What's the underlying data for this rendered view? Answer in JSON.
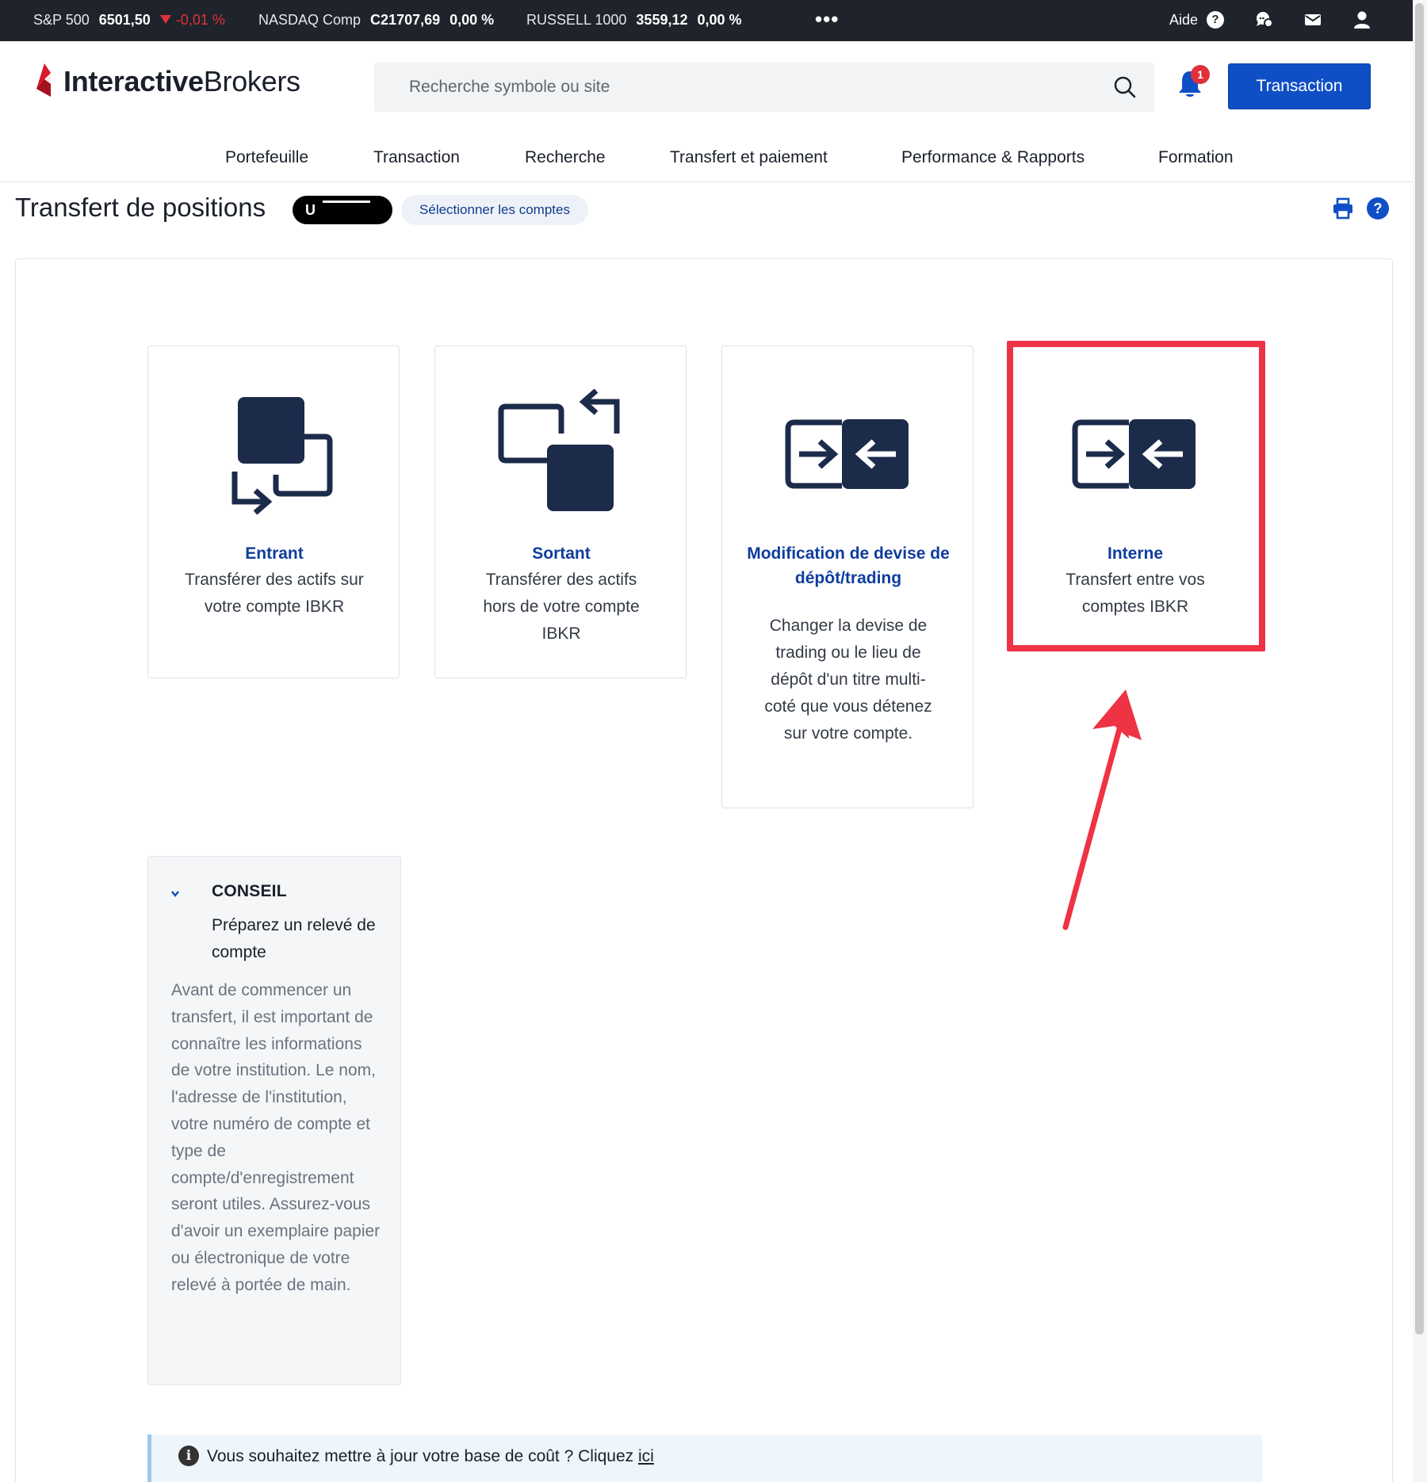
{
  "ticker": {
    "items": [
      {
        "name": "S&P 500",
        "value": "6501,50",
        "change": "-0,01 %",
        "direction": "down"
      },
      {
        "name": "NASDAQ Comp",
        "value": "C21707,69",
        "change": "0,00 %",
        "direction": "flat"
      },
      {
        "name": "RUSSELL 1000",
        "value": "3559,12",
        "change": "0,00 %",
        "direction": "flat"
      }
    ],
    "more": "•••",
    "help_label": "Aide",
    "help_glyph": "?",
    "icons": [
      "chat-icon",
      "mail-icon",
      "user-icon"
    ]
  },
  "header": {
    "logo_interactive": "Interactive",
    "logo_brokers": "Brokers",
    "search_placeholder": "Recherche symbole ou site",
    "notifications_count": "1",
    "trade_button": "Transaction"
  },
  "nav": {
    "items": [
      "Portefeuille",
      "Transaction",
      "Recherche",
      "Transfert et paiement",
      "Performance & Rapports",
      "Formation"
    ]
  },
  "page": {
    "title": "Transfert de positions",
    "account_prefix": "U",
    "select_accounts": "Sélectionner les comptes",
    "help_glyph": "?"
  },
  "cards": [
    {
      "title": "Entrant",
      "description": "Transférer des actifs sur votre compte IBKR",
      "icon": "incoming-transfer-icon"
    },
    {
      "title": "Sortant",
      "description": "Transférer des actifs hors de votre compte IBKR",
      "icon": "outgoing-transfer-icon"
    },
    {
      "title": "Modification de devise de dépôt/trading",
      "description": "Changer la devise de trading ou le lieu de dépôt d'un titre multi-coté que vous détenez sur votre compte.",
      "icon": "exchange-arrows-icon"
    },
    {
      "title": "Interne",
      "description": "Transfert entre vos comptes IBKR",
      "icon": "exchange-arrows-icon"
    }
  ],
  "tip": {
    "heading": "CONSEIL",
    "subheading": "Préparez un relevé de compte",
    "body": "Avant de commencer un transfert, il est important de connaître les informations de votre institution. Le nom, l'adresse de l'institution, votre numéro de compte et type de compte/d'enregistrement seront utiles. Assurez-vous d'avoir un exemplaire papier ou électronique de votre relevé à portée de main."
  },
  "info_banner": {
    "icon_glyph": "i",
    "message": "Vous souhaitez mettre à jour votre base de coût ? Cliquez ",
    "link": "ici"
  },
  "colors": {
    "brand_blue": "#0f4fc6",
    "link_blue": "#0f3d9e",
    "icon_navy": "#1c2b4a",
    "annotation_red": "#ee3344",
    "alert_red": "#e0313b"
  }
}
